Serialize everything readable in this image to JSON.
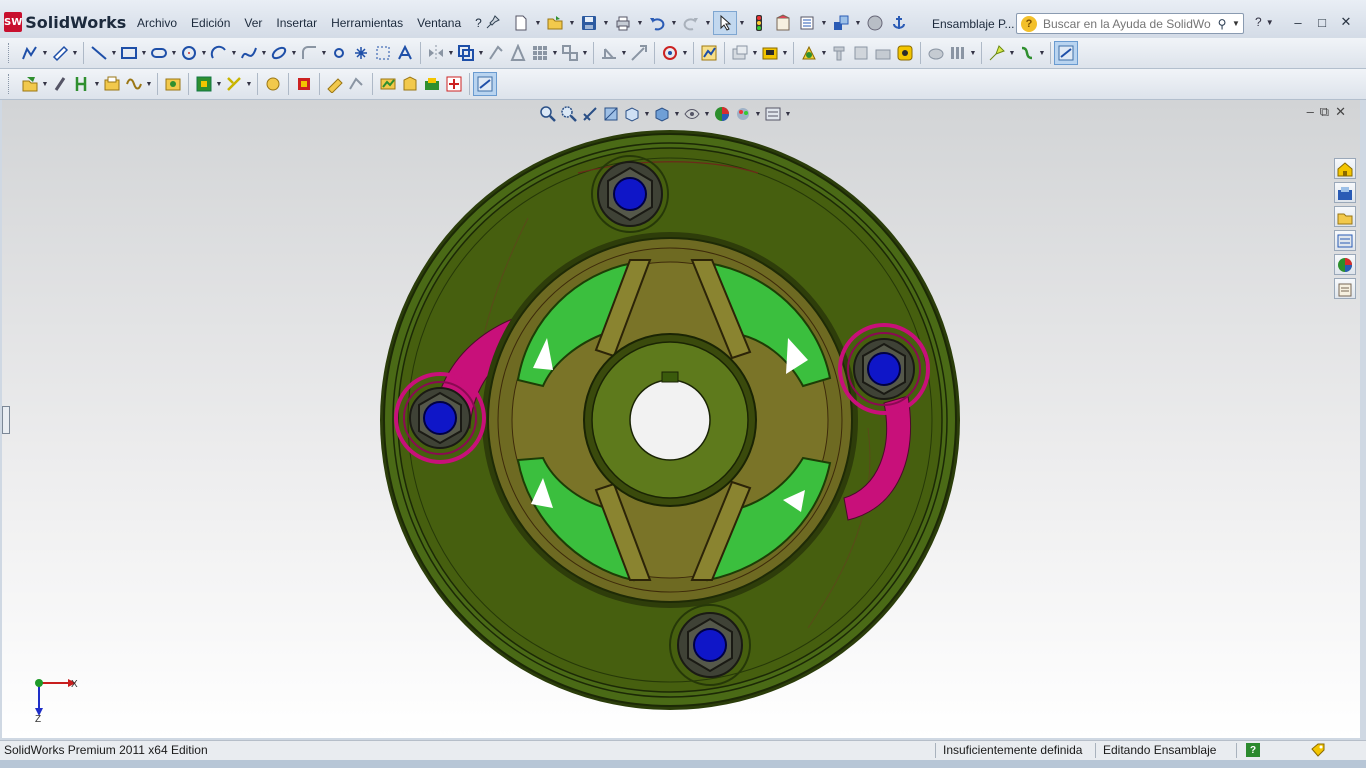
{
  "app": {
    "name": "SolidWorks",
    "logo_badge": "SW"
  },
  "menu": [
    "Archivo",
    "Edición",
    "Ver",
    "Insertar",
    "Herramientas",
    "Ventana",
    "?"
  ],
  "document_title": "Ensamblaje P...",
  "search": {
    "placeholder": "Buscar en la Ayuda de SolidWorks"
  },
  "help_menu": {
    "label": "?"
  },
  "window_controls": {
    "minimize": "–",
    "maximize": "□",
    "close": "✕"
  },
  "viewport_controls": {
    "minimize": "–",
    "restore": "⧉",
    "close": "✕"
  },
  "triad": {
    "x": "X",
    "z": "Z"
  },
  "status": {
    "edition": "SolidWorks Premium 2011 x64 Edition",
    "definition": "Insuficientemente definida",
    "mode": "Editando Ensamblaje",
    "help_badge": "?"
  },
  "colors": {
    "housing": "#3f5f12",
    "housing_dark": "#1f2e06",
    "green_pads": "#3bbf3e",
    "hub": "#7d7a2a",
    "pins": "#0f16c8",
    "magenta": "#c6106e"
  },
  "icons": {
    "row1": [
      "sketch",
      "smart-dimension",
      "line",
      "rectangle",
      "slot",
      "circle",
      "arc",
      "spline",
      "ellipse",
      "fillet",
      "point",
      "text",
      "mirror",
      "offset",
      "convert",
      "trim",
      "pattern",
      "move",
      "display-delete",
      "repair",
      "quick-snaps",
      "rapid-sketch",
      "instant3d",
      "insert-component",
      "mate",
      "linear-pattern",
      "smart-fasteners",
      "move-component",
      "show-hidden",
      "assembly-features",
      "reference-geometry",
      "new-motion",
      "bill-of-materials",
      "exploded-view",
      "explode-line",
      "interference",
      "clearance",
      "hole-alignment",
      "measure",
      "mass-properties",
      "section-view"
    ],
    "row2": [
      "features-edit",
      "attach",
      "split-line",
      "composite-curve",
      "helix",
      "weld-bead",
      "structure-member",
      "trim-extend",
      "end-cap",
      "gusset",
      "sheet-metal",
      "edge-flange",
      "miter-flange",
      "hem",
      "jog",
      "sketched-bend",
      "cross-break",
      "unfold",
      "fold",
      "flatten",
      "rip",
      "insert-bends",
      "corner",
      "toggle-grid"
    ],
    "heads_up": [
      "zoom-to-fit",
      "zoom-area",
      "previous-view",
      "section-view",
      "view-orientation",
      "display-style",
      "hide-show",
      "edit-appearance",
      "apply-scene",
      "view-settings"
    ],
    "taskpane": [
      "home",
      "resources",
      "design-library",
      "file-explorer",
      "view-palette",
      "appearances",
      "custom-properties"
    ]
  }
}
